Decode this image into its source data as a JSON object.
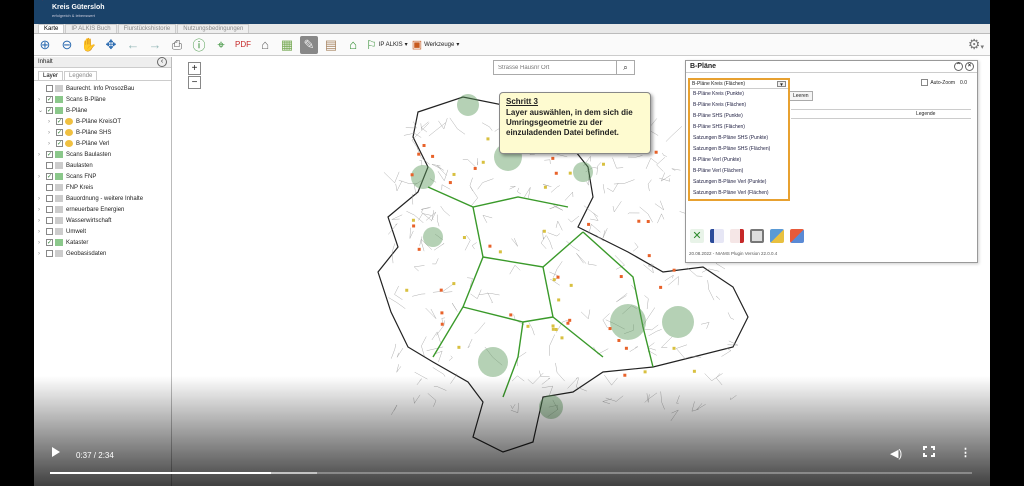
{
  "app": {
    "logo_title": "Kreis Gütersloh",
    "logo_subtitle": "erfolgreich & lebenswert"
  },
  "tabs": [
    "Karte",
    "IP ALKIS Buch",
    "Flurstückshistorie",
    "Nutzungsbedingungen"
  ],
  "toolbar": {
    "ip_alkis_label": "IP ALKIS",
    "werkzeuge_label": "Werkzeuge"
  },
  "sidebar": {
    "header": "Inhalt",
    "tabs": [
      "Layer",
      "Legende"
    ],
    "items": [
      {
        "label": "Baurecht. Info ProsozBau",
        "checked": false,
        "level": 0,
        "expandable": false
      },
      {
        "label": "Scans B-Pläne",
        "checked": true,
        "level": 0,
        "expandable": true
      },
      {
        "label": "B-Pläne",
        "checked": true,
        "level": 0,
        "expandable": true
      },
      {
        "label": "B-Pläne KreisOT",
        "checked": true,
        "level": 1,
        "expandable": true
      },
      {
        "label": "B-Pläne SHS",
        "checked": true,
        "level": 1,
        "expandable": true
      },
      {
        "label": "B-Pläne Verl",
        "checked": true,
        "level": 1,
        "expandable": true
      },
      {
        "label": "Scans Baulasten",
        "checked": true,
        "level": 0,
        "expandable": true
      },
      {
        "label": "Baulasten",
        "checked": false,
        "level": 0,
        "expandable": false
      },
      {
        "label": "Scans FNP",
        "checked": true,
        "level": 0,
        "expandable": true
      },
      {
        "label": "FNP Kreis",
        "checked": false,
        "level": 0,
        "expandable": false
      },
      {
        "label": "Bauordnung - weitere Inhalte",
        "checked": false,
        "level": 0,
        "expandable": true
      },
      {
        "label": "erneuerbare Energien",
        "checked": false,
        "level": 0,
        "expandable": true
      },
      {
        "label": "Wasserwirtschaft",
        "checked": false,
        "level": 0,
        "expandable": true
      },
      {
        "label": "Umwelt",
        "checked": false,
        "level": 0,
        "expandable": true
      },
      {
        "label": "Kataster",
        "checked": true,
        "level": 0,
        "expandable": true
      },
      {
        "label": "Geobasisdaten",
        "checked": false,
        "level": 0,
        "expandable": true
      }
    ]
  },
  "map": {
    "zoom_in": "+",
    "zoom_out": "−",
    "search_placeholder": "Strasse Hausnr Ort"
  },
  "callout": {
    "step": "Schritt 3",
    "text": "Layer auswählen, in dem sich die Umringsgeometrie zu der einzuladenden Datei befindet."
  },
  "panel": {
    "title": "B-Pläne",
    "selected": "B-Pläne Kreis (Flächen)",
    "options": [
      "B-Pläne Kreis (Punkte)",
      "B-Pläne Kreis (Flächen)",
      "B-Pläne SHS (Punkte)",
      "B-Pläne SHS (Flächen)",
      "Satzungen B-Pläne SHS (Punkte)",
      "Satzungen B-Pläne SHS (Flächen)",
      "B-Pläne Verl (Punkte)",
      "B-Pläne Verl (Flächen)",
      "Satzungen B-Pläne Verl (Punkte)",
      "Satzungen B-Pläne Verl (Flächen)"
    ],
    "autozoom_label": "Auto-Zoom",
    "autozoom_value": "0.0",
    "leeren_label": "Leeren",
    "legend_col": "Legende",
    "version": "20.08.2022 - NIAMS Plugin Version 22.0.0.4"
  },
  "video": {
    "time": "0:37 / 2:34",
    "played_fraction": 0.24,
    "buffered_fraction": 0.29
  },
  "colors": {
    "topbar": "#1a4269",
    "accent_orange": "#e8a130",
    "district_border": "#3a9a2a"
  }
}
